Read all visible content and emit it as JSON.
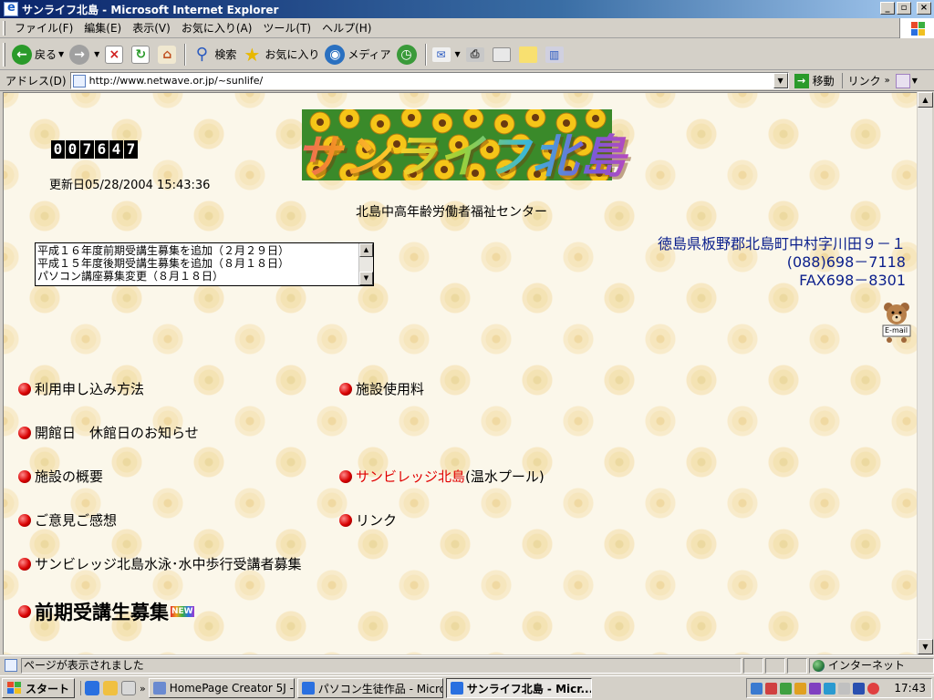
{
  "window": {
    "title": "サンライフ北島 - Microsoft Internet Explorer"
  },
  "menu": [
    "ファイル(F)",
    "編集(E)",
    "表示(V)",
    "お気に入り(A)",
    "ツール(T)",
    "ヘルプ(H)"
  ],
  "toolbar": {
    "back": "戻る",
    "search": "検索",
    "favorites": "お気に入り",
    "media": "メディア"
  },
  "address": {
    "label": "アドレス(D)",
    "url": "http://www.netwave.or.jp/~sunlife/",
    "go": "移動",
    "links": "リンク"
  },
  "page": {
    "counter": [
      "0",
      "0",
      "7",
      "6",
      "4",
      "7"
    ],
    "updated": "更新日05/28/2004 15:43:36",
    "logo_text": "サンライフ北島",
    "subtitle": "北島中高年齢労働者福祉センター",
    "news": [
      "平成１６年度前期受講生募集を追加（２月２９日）",
      "平成１５年度後期受講生募集を追加（８月１８日）",
      "パソコン講座募集変更（８月１８日）"
    ],
    "address_lines": [
      "徳島県板野郡北島町中村字川田９－１",
      "(088)698－7118",
      "FAX698－8301"
    ],
    "email_badge": "E-mail",
    "nav": {
      "how_to_apply": "利用申し込み方法",
      "facility_fee": "施設使用料",
      "open_days": "開館日　休館日のお知らせ",
      "facility_overview": "施設の概要",
      "sunvillage": "サンビレッジ北島",
      "sunvillage_suffix": "(温水プール)",
      "feedback": "ご意見ご感想",
      "links": "リンク",
      "swim_recruit": "サンビレッジ北島水泳･水中歩行受講者募集",
      "spring_recruit": "前期受講生募集",
      "new_badge": "NEW"
    }
  },
  "status": {
    "text": "ページが表示されました",
    "zone": "インターネット"
  },
  "taskbar": {
    "start": "スタート",
    "tasks": [
      "HomePage Creator 5J -...",
      "パソコン生徒作品 - Micro...",
      "サンライフ北島 - Micr..."
    ],
    "clock": "17:43"
  }
}
